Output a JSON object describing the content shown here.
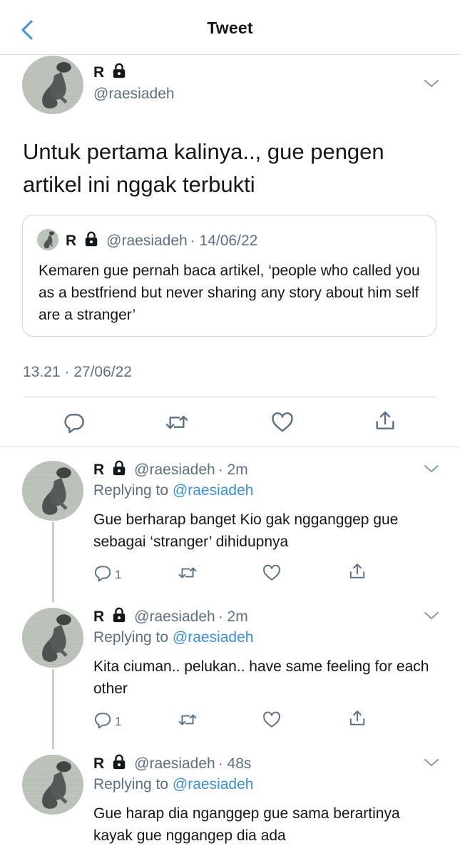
{
  "nav": {
    "title": "Tweet",
    "back_icon": "chevron-left-icon"
  },
  "main_tweet": {
    "name": "R",
    "handle": "@raesiadeh",
    "text": "Untuk pertama kalinya.., gue pengen artikel ini nggak terbukti",
    "quote": {
      "name": "R",
      "handle": "@raesiadeh",
      "date": "· 14/06/22",
      "text": "Kemaren gue pernah baca artikel, ‘people who called you as a bestfriend but never sharing any story about him self are a stranger’"
    },
    "timestamp": "13.21 · 27/06/22",
    "actions": [
      "reply-icon",
      "retweet-icon",
      "like-icon",
      "share-icon"
    ]
  },
  "replies": [
    {
      "name": "R",
      "handle": "@raesiadeh",
      "time": "· 2m",
      "replying_prefix": "Replying to",
      "replying_to": "@raesiadeh",
      "text": "Gue berharap banget Kio gak ngganggep gue sebagai ‘stranger’ dihidupnya",
      "reply_count": "1"
    },
    {
      "name": "R",
      "handle": "@raesiadeh",
      "time": "· 2m",
      "replying_prefix": "Replying to",
      "replying_to": "@raesiadeh",
      "text": "Kita ciuman.. pelukan.. have same feeling for each other",
      "reply_count": "1"
    },
    {
      "name": "R",
      "handle": "@raesiadeh",
      "time": "· 48s",
      "replying_prefix": "Replying to",
      "replying_to": "@raesiadeh",
      "text": "Gue harap dia nganggep gue sama berartinya kayak gue nggangep dia ada"
    }
  ],
  "colors": {
    "link": "#3b90d8",
    "secondary": "#5b7083",
    "divider": "#d7dce0"
  }
}
